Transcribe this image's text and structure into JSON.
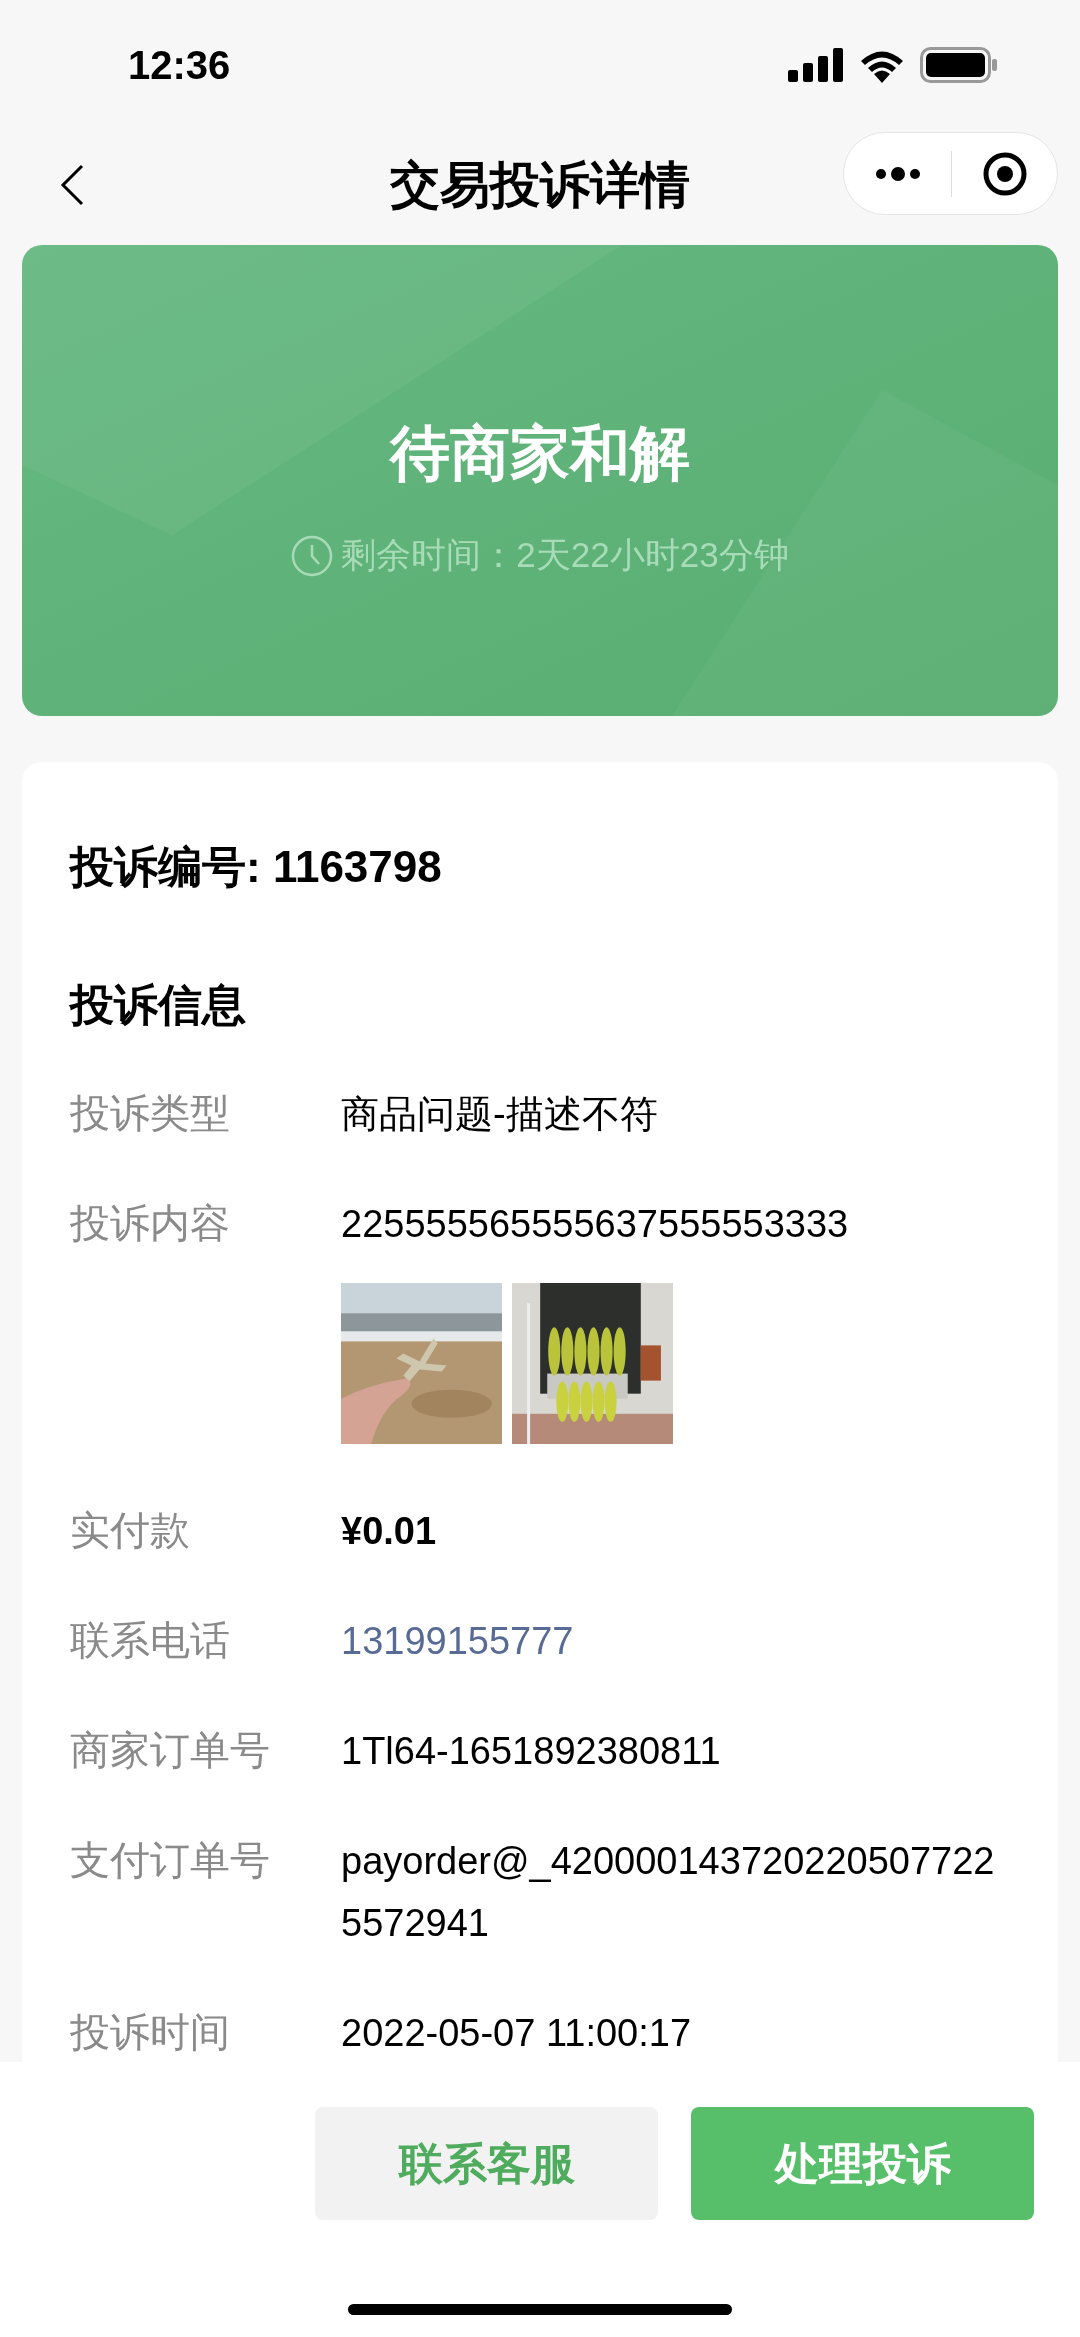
{
  "status_bar": {
    "time": "12:36"
  },
  "nav": {
    "title": "交易投诉详情"
  },
  "banner": {
    "title": "待商家和解",
    "countdown": "剩余时间：2天22小时23分钟"
  },
  "complaint": {
    "number": "投诉编号: 1163798",
    "section_title": "投诉信息",
    "rows": [
      {
        "kind": "text",
        "label": "投诉类型",
        "value": "商品问题-描述不符"
      },
      {
        "kind": "text",
        "label": "投诉内容",
        "value": "225555565555637555553333"
      },
      {
        "kind": "pictures"
      },
      {
        "kind": "amount",
        "label": "实付款",
        "value": "¥0.01"
      },
      {
        "kind": "link",
        "label": "联系电话",
        "value": "13199155777"
      },
      {
        "kind": "text",
        "label": "商家订单号",
        "value": "1Tl64-1651892380811"
      },
      {
        "kind": "text",
        "label": "支付订单号",
        "value": "payorder@_4200001437202205077225572941"
      },
      {
        "kind": "text",
        "label": "投诉时间",
        "value": "2022-05-07 11:00:17"
      }
    ]
  },
  "buttons": [
    {
      "label": "联系客服",
      "kind": "secondary"
    },
    {
      "label": "处理投诉",
      "kind": "primary"
    }
  ]
}
